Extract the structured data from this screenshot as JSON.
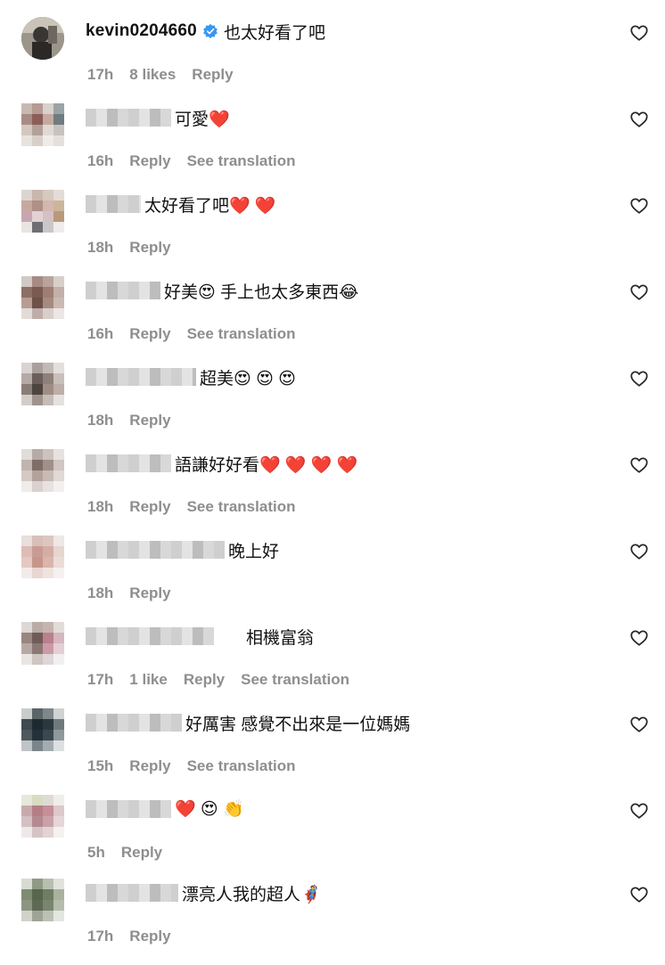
{
  "comments": [
    {
      "username": "kevin0204660",
      "verified": true,
      "text": "也太好看了吧",
      "time": "17h",
      "likes": "8 likes",
      "reply": "Reply",
      "translation": ""
    },
    {
      "username": "",
      "text": "可愛❤️",
      "time": "16h",
      "likes": "",
      "reply": "Reply",
      "translation": "See translation"
    },
    {
      "username": "",
      "text": "太好看了吧❤️ ❤️",
      "time": "18h",
      "likes": "",
      "reply": "Reply",
      "translation": ""
    },
    {
      "username": "",
      "text": "好美😍 手上也太多東西😂",
      "time": "16h",
      "likes": "",
      "reply": "Reply",
      "translation": "See translation"
    },
    {
      "username": "",
      "text": "超美😍 😍 😍",
      "time": "18h",
      "likes": "",
      "reply": "Reply",
      "translation": ""
    },
    {
      "username": "",
      "text": "語謙好好看❤️ ❤️ ❤️ ❤️",
      "time": "18h",
      "likes": "",
      "reply": "Reply",
      "translation": "See translation"
    },
    {
      "username": "",
      "text": "晚上好",
      "time": "18h",
      "likes": "",
      "reply": "Reply",
      "translation": ""
    },
    {
      "username": "",
      "text": "相機富翁",
      "time": "17h",
      "likes": "1 like",
      "reply": "Reply",
      "translation": "See translation"
    },
    {
      "username": "",
      "text": "好厲害 感覺不出來是一位媽媽",
      "time": "15h",
      "likes": "",
      "reply": "Reply",
      "translation": "See translation"
    },
    {
      "username": "",
      "text": "❤️ 😍 👏",
      "time": "5h",
      "likes": "",
      "reply": "Reply",
      "translation": ""
    },
    {
      "username": "",
      "text": "漂亮人我的超人🦸",
      "time": "17h",
      "likes": "",
      "reply": "Reply",
      "translation": ""
    }
  ],
  "colors": {
    "verified": "#3897f0",
    "meta": "#8e8e8e",
    "text": "#111111"
  },
  "icons": {
    "like": "heart-outline-icon",
    "verified": "verified-badge-icon"
  }
}
